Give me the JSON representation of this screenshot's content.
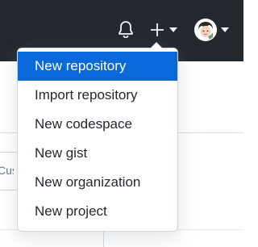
{
  "header": {
    "icons": {
      "notifications": "bell-icon",
      "create": "plus-icon",
      "caret": "caret-down-icon",
      "avatar": "user-avatar"
    }
  },
  "background": {
    "partial_input_text": "Cust"
  },
  "menu": {
    "items": [
      {
        "label": "New repository",
        "active": true
      },
      {
        "label": "Import repository",
        "active": false
      },
      {
        "label": "New codespace",
        "active": false
      },
      {
        "label": "New gist",
        "active": false
      },
      {
        "label": "New organization",
        "active": false
      },
      {
        "label": "New project",
        "active": false
      }
    ]
  },
  "colors": {
    "header_bg": "#24292f",
    "menu_active_bg": "#0969da",
    "menu_text": "#24292f",
    "border": "#d0d7de"
  }
}
